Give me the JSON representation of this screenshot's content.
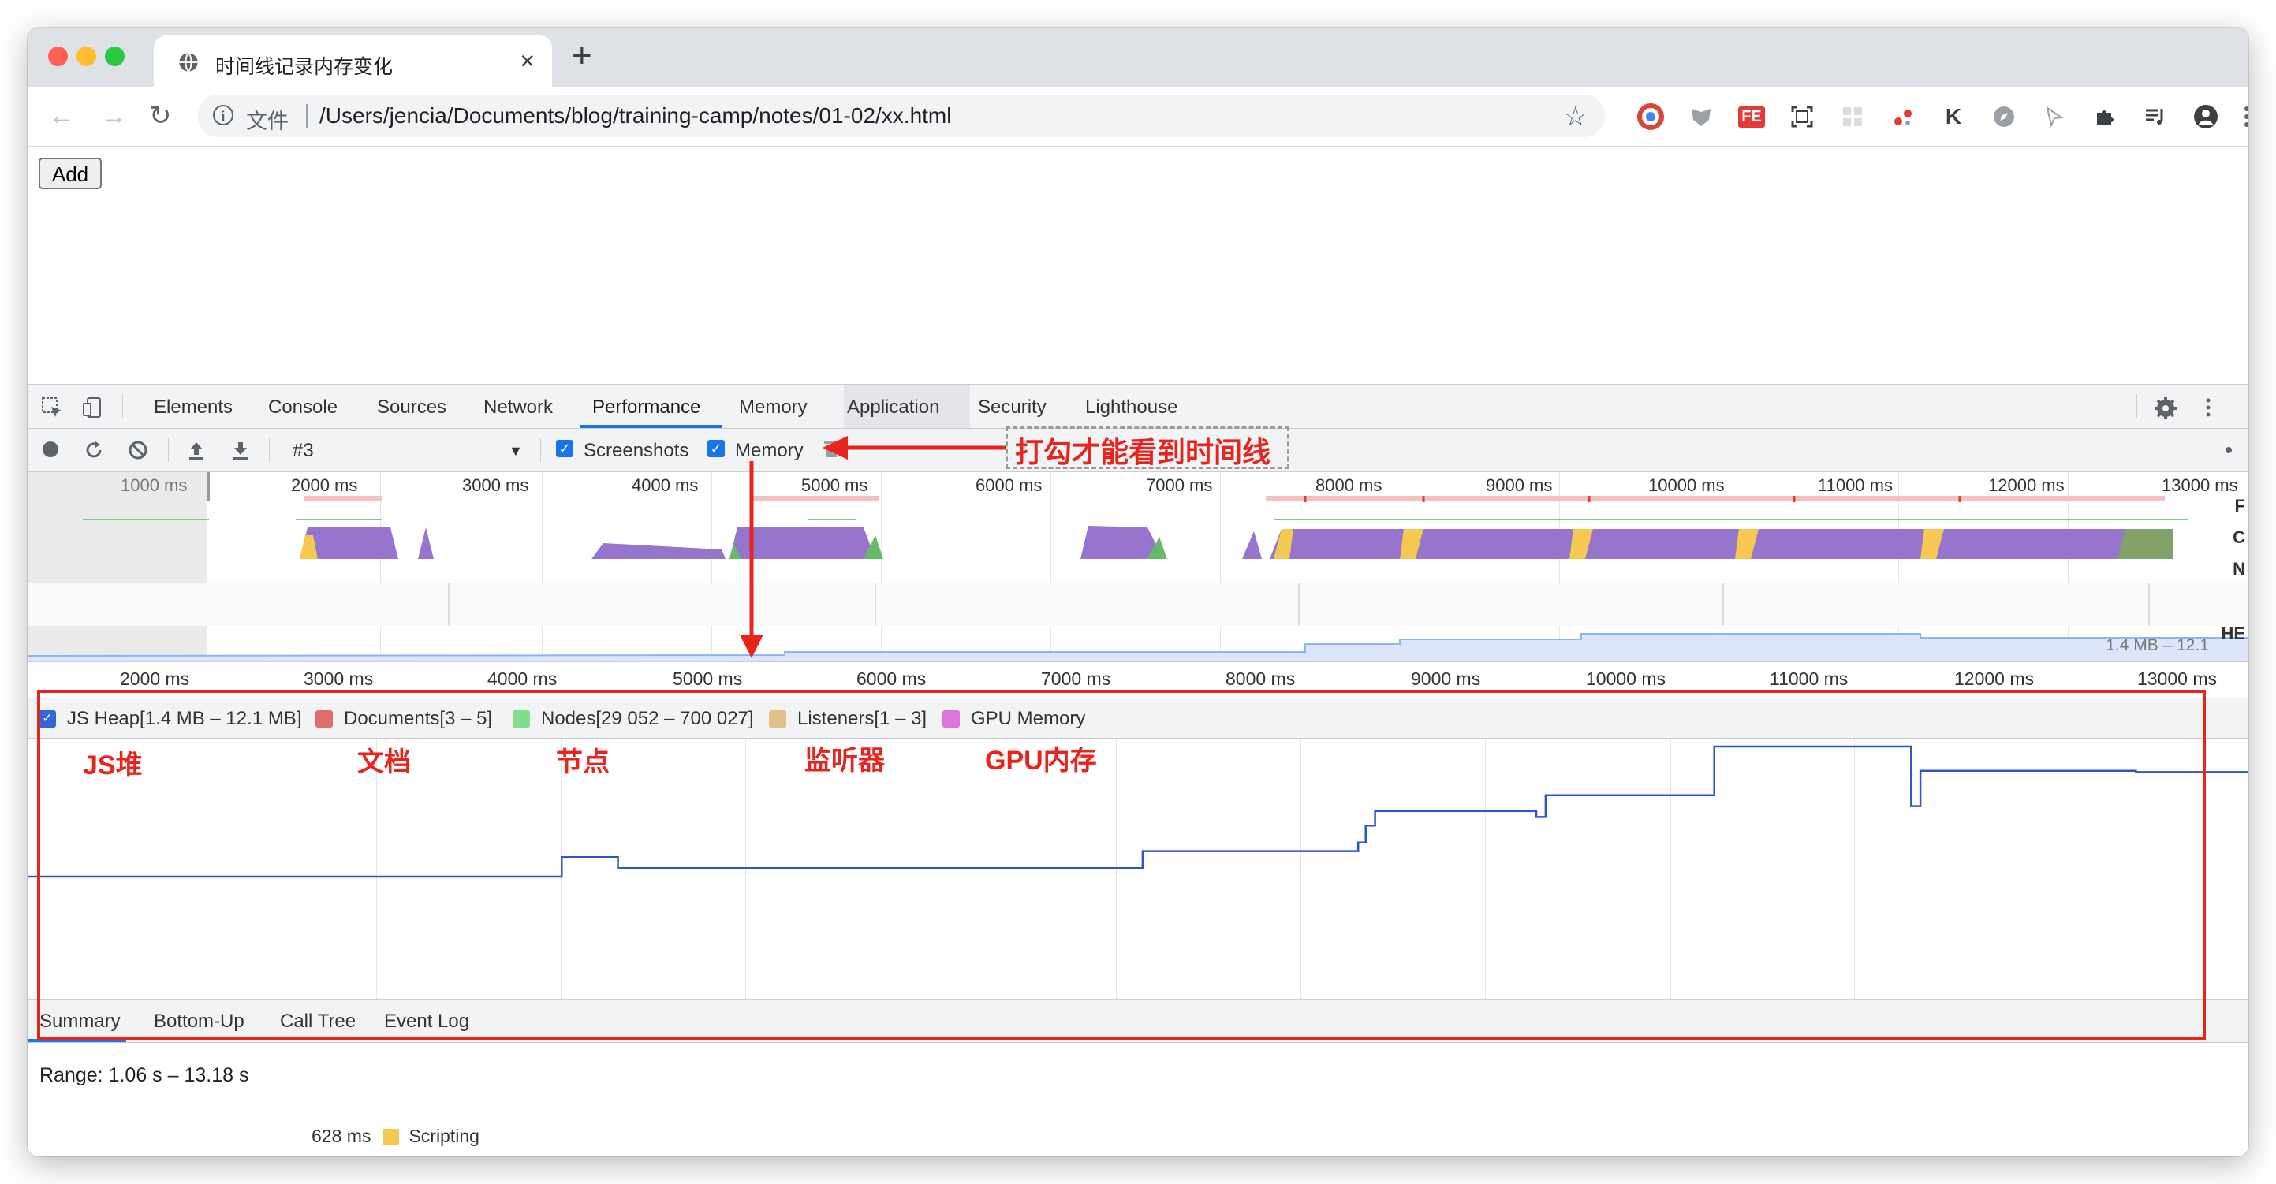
{
  "browser": {
    "tab_title": "时间线记录内存变化",
    "tab_close": "×",
    "new_tab": "+",
    "omnibox_label": "文件",
    "url": "/Users/jencia/Documents/blog/training-camp/notes/01-02/xx.html",
    "extensions": [
      "chrome-icon",
      "mask-icon",
      "fe-icon",
      "capture-icon",
      "grid-icon",
      "dots-icon",
      "k-icon",
      "compass-icon",
      "cursor-icon",
      "puzzle-icon",
      "playlist-icon",
      "profile-icon",
      "menu-icon"
    ],
    "extension_text": {
      "fe": "FE",
      "k": "K"
    }
  },
  "page": {
    "add_button": "Add"
  },
  "devtools": {
    "tabs": [
      "Elements",
      "Console",
      "Sources",
      "Network",
      "Performance",
      "Memory",
      "Application",
      "Security",
      "Lighthouse"
    ],
    "active_tab": "Performance",
    "profile_select": "#3",
    "screenshots_label": "Screenshots",
    "memory_label": "Memory",
    "overview_ticks": [
      "1000 ms",
      "2000 ms",
      "3000 ms",
      "4000 ms",
      "5000 ms",
      "6000 ms",
      "7000 ms",
      "8000 ms",
      "9000 ms",
      "10000 ms",
      "11000 ms",
      "12000 ms",
      "13000 ms"
    ],
    "overview_row_letters": [
      "F",
      "C",
      "N",
      "HE"
    ],
    "overview_heap_label": "1.4 MB – 12.1",
    "ruler_ticks": [
      "2000 ms",
      "3000 ms",
      "4000 ms",
      "5000 ms",
      "6000 ms",
      "7000 ms",
      "8000 ms",
      "9000 ms",
      "10000 ms",
      "11000 ms",
      "12000 ms",
      "13000 ms"
    ],
    "legend": [
      {
        "label": "JS Heap[1.4 MB – 12.1 MB]",
        "color": "#3367d6",
        "checked": true
      },
      {
        "label": "Documents[3 – 5]",
        "color": "#de6d6d"
      },
      {
        "label": "Nodes[29 052 – 700 027]",
        "color": "#82dd8e"
      },
      {
        "label": "Listeners[1 – 3]",
        "color": "#e0bf8a"
      },
      {
        "label": "GPU Memory",
        "color": "#dd74de"
      }
    ],
    "bottom_tabs": [
      "Summary",
      "Bottom-Up",
      "Call Tree",
      "Event Log"
    ],
    "range_text": "Range: 1.06 s – 13.18 s",
    "summary_row": {
      "value": "628 ms",
      "label": "Scripting"
    }
  },
  "annotations": {
    "memory_hint": "打勾才能看到时间线",
    "js_heap": "JS堆",
    "documents": "文档",
    "nodes": "节点",
    "listeners": "监听器",
    "gpu": "GPU内存"
  },
  "chart_data": {
    "type": "line",
    "series": [
      {
        "name": "JS Heap[1.4 MB – 12.1 MB]",
        "x_ms": [
          1450,
          2000,
          2300,
          3300,
          4300,
          4600,
          5050,
          5500,
          6000,
          6500,
          7000,
          7400,
          7800,
          7830,
          8200,
          8550,
          8590,
          8640,
          8680,
          9500,
          9550,
          9600,
          10400,
          10450,
          11000,
          11450,
          11500,
          11550,
          12000,
          12700,
          13300
        ],
        "y_mb": [
          1.4,
          1.4,
          1.4,
          1.4,
          3.0,
          2.1,
          2.1,
          2.1,
          2.1,
          2.1,
          2.1,
          3.5,
          3.5,
          3.5,
          3.5,
          4.2,
          5.6,
          6.8,
          6.8,
          6.3,
          8.1,
          8.1,
          8.1,
          12.1,
          12.1,
          12.1,
          7.2,
          10.1,
          10.1,
          10.0,
          10.0
        ]
      }
    ],
    "xlim_ms": [
      1450,
      13300
    ],
    "ylim_mb": [
      1.4,
      12.1
    ]
  }
}
